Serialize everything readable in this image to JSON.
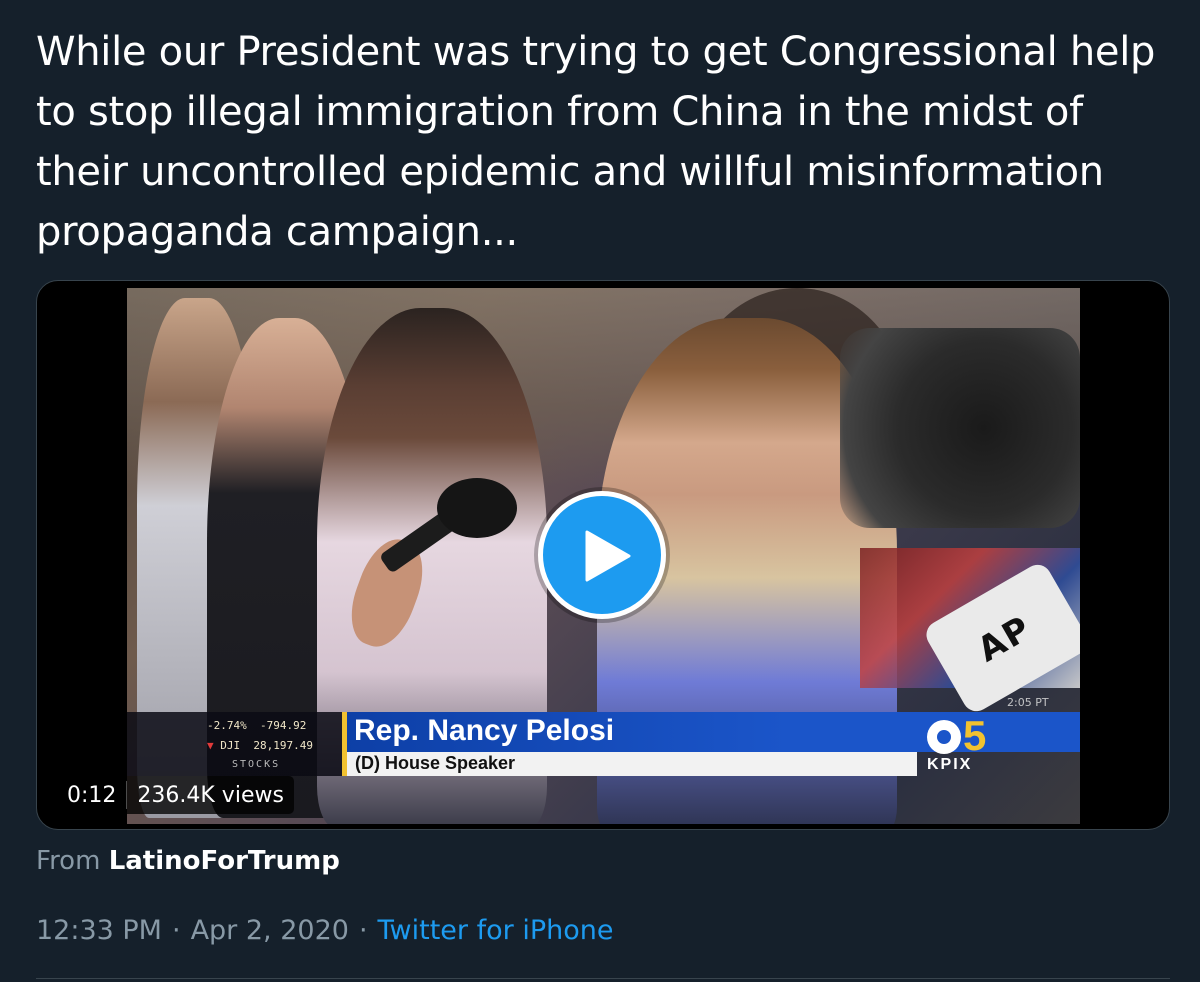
{
  "tweet": {
    "text": "While our President was trying to get Congressional help to stop illegal immigration from China in the midst of their uncontrolled epidemic and willful misinformation propaganda campaign..."
  },
  "video": {
    "duration": "0:12",
    "views": "236.4K views",
    "play_icon": "play-icon",
    "overlay": {
      "stocks": {
        "row1_change": "-2.74%",
        "row1_points": "-794.92",
        "row2_index": "DJI",
        "row2_value": "28,197.49",
        "row3_label": "STOCKS"
      },
      "name": "Rep. Nancy Pelosi",
      "title": "(D) House Speaker",
      "station_number": "5",
      "station_call": "KPIX",
      "mic_flag": "AP",
      "burn_time": "2:05 PT"
    }
  },
  "source": {
    "prefix": "From",
    "account": "LatinoForTrump"
  },
  "meta": {
    "time": "12:33 PM",
    "sep1": "·",
    "date": "Apr 2, 2020",
    "sep2": "·",
    "app": "Twitter for iPhone"
  },
  "colors": {
    "background": "#15202b",
    "accent": "#1d9bf0",
    "secondary_text": "#8899a6"
  }
}
